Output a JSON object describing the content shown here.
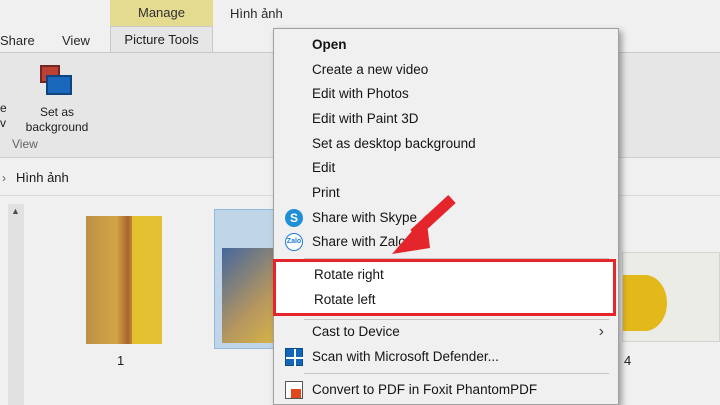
{
  "ribbon": {
    "tab_manage": "Manage",
    "tab_folder": "Hình ảnh",
    "tab_share": "Share",
    "tab_view": "View",
    "tab_picture_tools": "Picture Tools",
    "set_as_background": "Set as background",
    "group_view": "View"
  },
  "address": {
    "crumb": "Hình ảnh"
  },
  "files": [
    {
      "label": "1"
    },
    {
      "label": "4"
    }
  ],
  "context_menu": {
    "items": [
      {
        "label": "Open"
      },
      {
        "label": "Create a new video"
      },
      {
        "label": "Edit with Photos"
      },
      {
        "label": "Edit with Paint 3D"
      },
      {
        "label": "Set as desktop background"
      },
      {
        "label": "Edit"
      },
      {
        "label": "Print"
      },
      {
        "label": "Share with Skype"
      },
      {
        "label": "Share with Zalo"
      },
      {
        "label": "Rotate right"
      },
      {
        "label": "Rotate left"
      },
      {
        "label": "Cast to Device"
      },
      {
        "label": "Scan with Microsoft Defender..."
      },
      {
        "label": "Convert to PDF in Foxit PhantomPDF"
      }
    ]
  },
  "colors": {
    "highlight": "#e4262c",
    "manage_tab": "#f3e99a"
  },
  "icons": {
    "skype": "skype-icon",
    "zalo": "zalo-icon",
    "defender": "defender-icon",
    "pdf": "foxit-pdf-icon",
    "submenu": "chevron-right-icon"
  }
}
